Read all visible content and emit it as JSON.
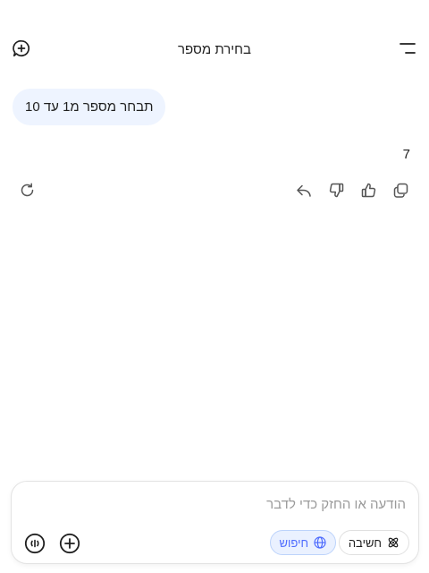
{
  "header": {
    "title": "בחירת מספר",
    "menu_icon": "menu-icon",
    "new_chat_icon": "new-chat-icon"
  },
  "conversation": {
    "user_message": "תבחר מספר מ1 עד 10",
    "assistant_reply": "7",
    "actions": [
      "copy-icon",
      "thumbs-up-icon",
      "thumbs-down-icon",
      "share-icon",
      "regenerate-icon"
    ]
  },
  "composer": {
    "placeholder": "הודעה או החזק כדי לדבר",
    "think_label": "חשיבה",
    "search_label": "חיפוש",
    "accent_color": "#4d6bfe",
    "bubble_color": "#eef4ff"
  }
}
